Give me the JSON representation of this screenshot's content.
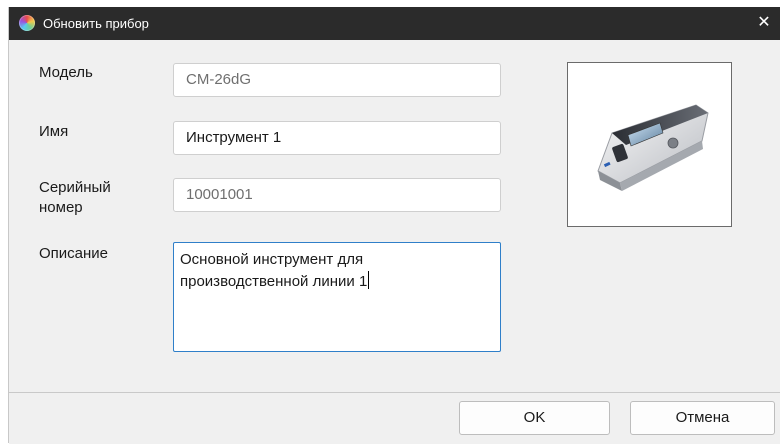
{
  "window": {
    "title": "Обновить прибор",
    "icon": "color-wheel-icon",
    "close_glyph": "✕"
  },
  "form": {
    "model": {
      "label": "Модель",
      "value": "CM-26dG"
    },
    "name": {
      "label": "Имя",
      "value": "Инструмент 1"
    },
    "serial": {
      "label_line1": "Серийный",
      "label_line2": "номер",
      "value": "10001001"
    },
    "description": {
      "label": "Описание",
      "line1": "Основной инструмент для",
      "line2": "производственной линии 1"
    }
  },
  "device_image": {
    "icon": "spectrophotometer-device-icon"
  },
  "buttons": {
    "ok": "OK",
    "cancel": "Отмена"
  }
}
